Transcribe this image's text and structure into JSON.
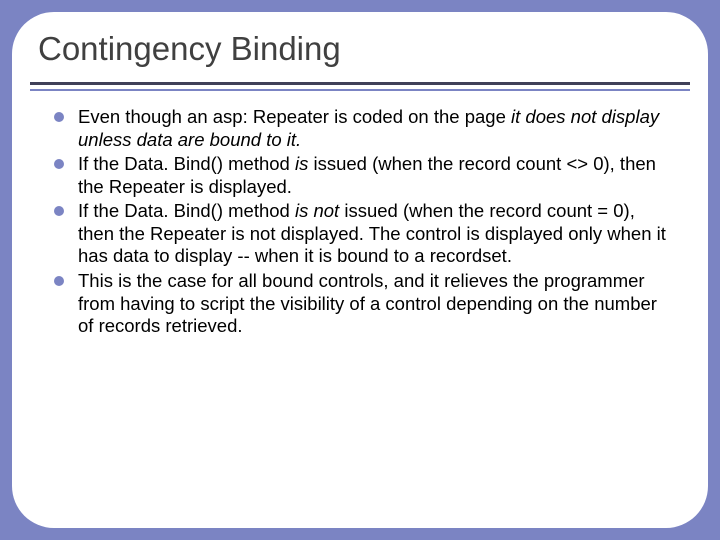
{
  "slide": {
    "title": "Contingency Binding",
    "bullets": [
      {
        "pre": "Even though an asp: Repeater is coded on the page ",
        "em1": "it does not display unless data are bound to it.",
        "post": ""
      },
      {
        "pre": "If the Data. Bind() method ",
        "em1": "is",
        "mid": " issued (when the record count <> 0), then the Repeater is displayed.",
        "post": ""
      },
      {
        "pre": "If the Data. Bind() method ",
        "em1": "is not",
        "mid": " issued (when the record count = 0), then the Repeater is not displayed. The control is displayed only when it has data to display -- when it is bound to a recordset.",
        "post": ""
      },
      {
        "pre": "This is the case for all bound controls, and it relieves the programmer from having to script the visibility of a control depending on the number of records retrieved.",
        "em1": "",
        "mid": "",
        "post": ""
      }
    ]
  }
}
